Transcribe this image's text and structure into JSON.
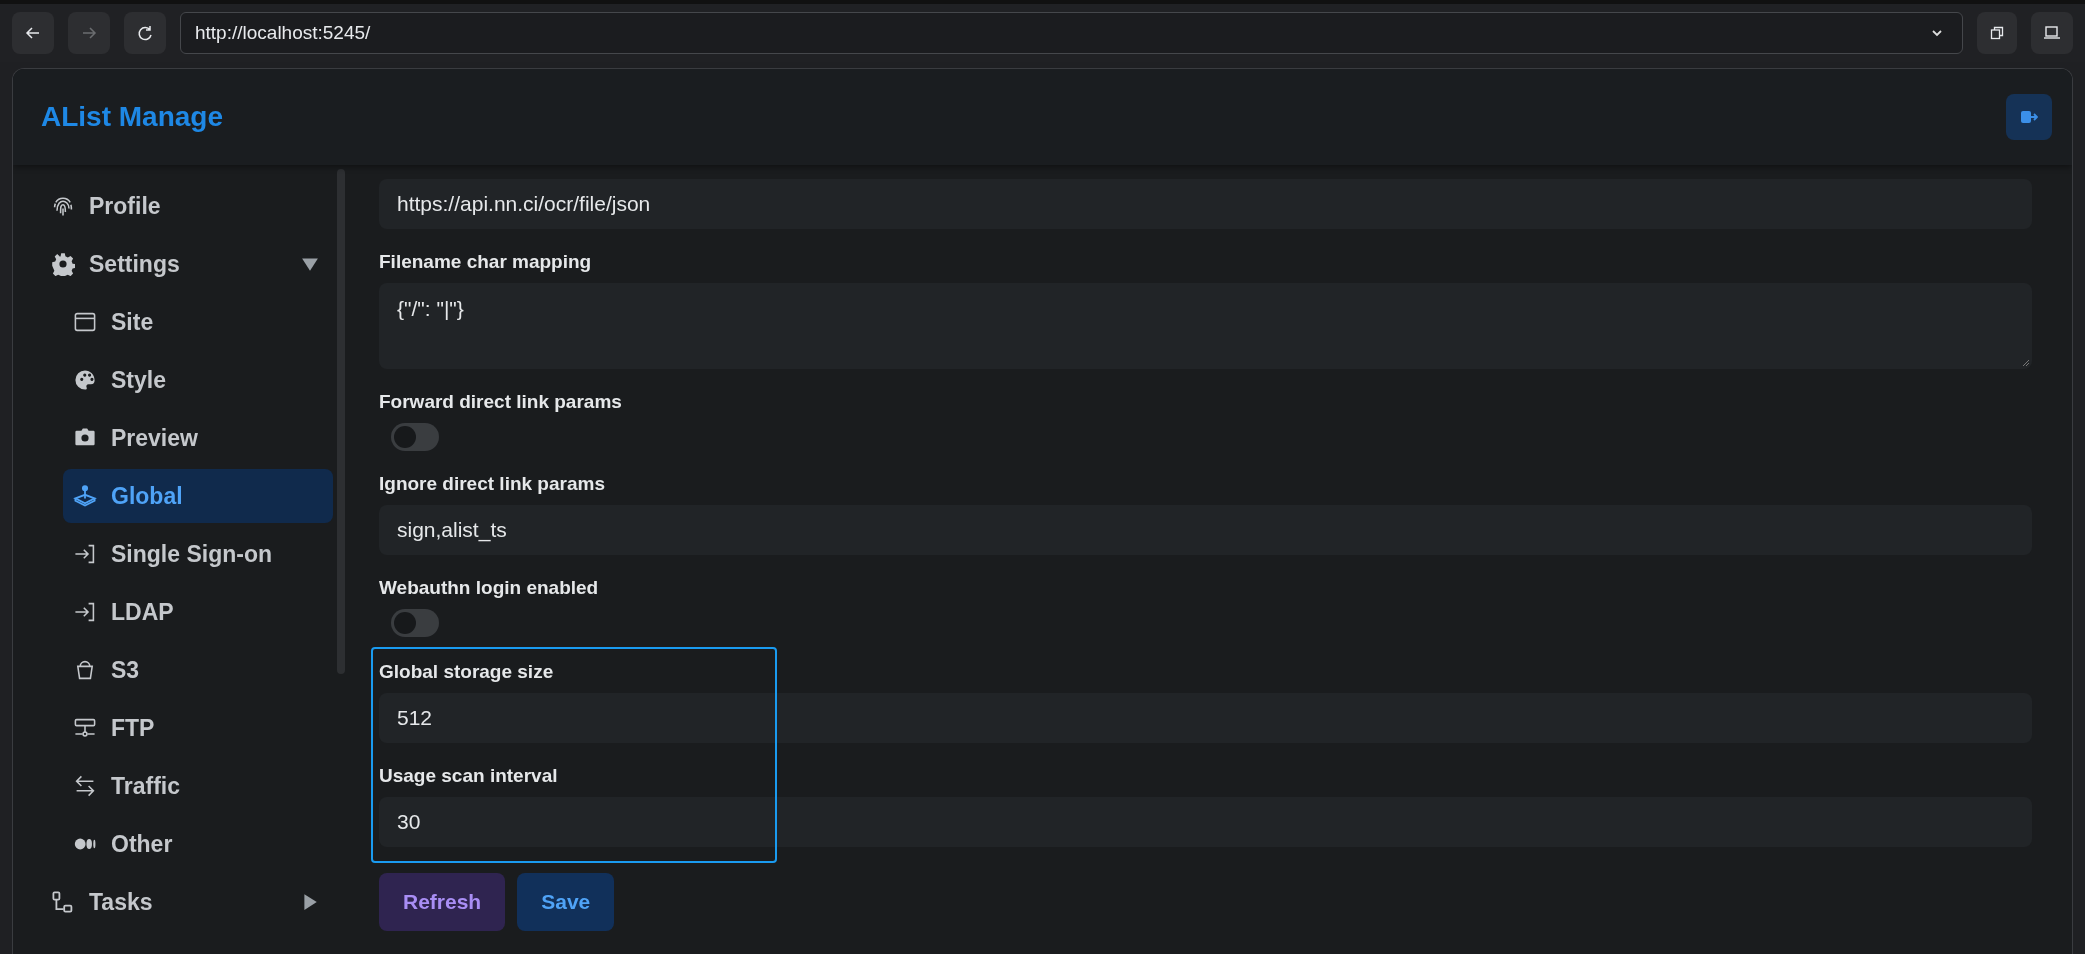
{
  "browser": {
    "back_disabled": false,
    "forward_disabled": true,
    "url": "http://localhost:5245/"
  },
  "app": {
    "title": "AList Manage"
  },
  "sidebar": {
    "items": [
      {
        "label": "Profile",
        "selected": false
      },
      {
        "label": "Settings",
        "selected": false,
        "expanded": true,
        "children": [
          {
            "label": "Site",
            "selected": false
          },
          {
            "label": "Style",
            "selected": false
          },
          {
            "label": "Preview",
            "selected": false
          },
          {
            "label": "Global",
            "selected": true
          },
          {
            "label": "Single Sign-on",
            "selected": false
          },
          {
            "label": "LDAP",
            "selected": false
          },
          {
            "label": "S3",
            "selected": false
          },
          {
            "label": "FTP",
            "selected": false
          },
          {
            "label": "Traffic",
            "selected": false
          },
          {
            "label": "Other",
            "selected": false
          }
        ]
      },
      {
        "label": "Tasks",
        "selected": false,
        "expanded": false
      }
    ]
  },
  "sections": [
    {
      "highlighted": false,
      "fields": [
        {
          "kind": "input",
          "value": "https://api.nn.ci/ocr/file/json"
        },
        {
          "kind": "textarea",
          "label": "Filename char mapping",
          "value": "{\"/\": \"|\"}"
        },
        {
          "kind": "switch",
          "label": "Forward direct link params",
          "on": false
        },
        {
          "kind": "input",
          "label": "Ignore direct link params",
          "value": "sign,alist_ts"
        },
        {
          "kind": "switch",
          "label": "Webauthn login enabled",
          "on": false
        }
      ]
    },
    {
      "highlighted": true,
      "fields": [
        {
          "kind": "input",
          "label": "Global storage size",
          "value": "512"
        },
        {
          "kind": "input",
          "label": "Usage scan interval",
          "value": "30"
        }
      ]
    }
  ],
  "buttons": [
    {
      "kind": "secondary",
      "label": "Refresh"
    },
    {
      "kind": "primary",
      "label": "Save"
    }
  ]
}
